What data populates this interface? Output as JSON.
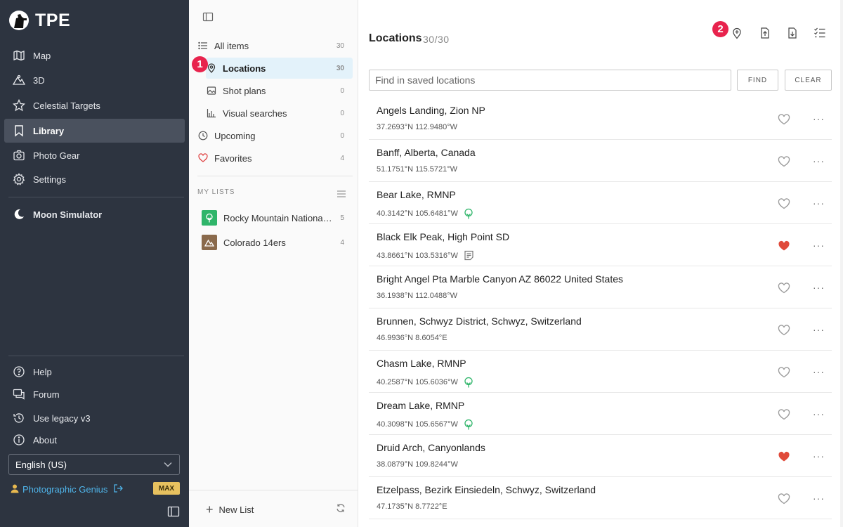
{
  "brand": {
    "name": "TPE"
  },
  "nav": {
    "items": [
      {
        "label": "Map",
        "icon": "map-icon"
      },
      {
        "label": "3D",
        "icon": "mountain-icon"
      },
      {
        "label": "Celestial Targets",
        "icon": "star-icon"
      },
      {
        "label": "Library",
        "icon": "bookmark-icon",
        "active": true
      },
      {
        "label": "Photo Gear",
        "icon": "camera-icon"
      },
      {
        "label": "Settings",
        "icon": "gear-icon"
      },
      {
        "label": "Moon Simulator",
        "icon": "moon-icon"
      }
    ],
    "bottom": [
      {
        "label": "Help",
        "icon": "help-icon"
      },
      {
        "label": "Forum",
        "icon": "forum-icon"
      },
      {
        "label": "Use legacy v3",
        "icon": "history-icon"
      },
      {
        "label": "About",
        "icon": "info-icon"
      }
    ],
    "language": "English (US)",
    "user": "Photographic Genius",
    "badge": "MAX"
  },
  "library": {
    "items": [
      {
        "label": "All items",
        "count": "30",
        "icon": "list-icon"
      },
      {
        "label": "Locations",
        "count": "30",
        "icon": "pin-icon",
        "active": true
      },
      {
        "label": "Shot plans",
        "count": "0",
        "icon": "image-icon"
      },
      {
        "label": "Visual searches",
        "count": "0",
        "icon": "chart-icon"
      },
      {
        "label": "Upcoming",
        "count": "0",
        "icon": "clock-icon"
      },
      {
        "label": "Favorites",
        "count": "4",
        "icon": "heart-icon"
      }
    ],
    "my_lists_title": "MY LISTS",
    "lists": [
      {
        "name": "Rocky Mountain National Park",
        "count": "5",
        "color": "#2fb56a"
      },
      {
        "name": "Colorado 14ers",
        "count": "4",
        "color": "#8a6a4c"
      }
    ],
    "new_list": "New List"
  },
  "callouts": {
    "one": "1",
    "two": "2"
  },
  "main": {
    "title": "Locations",
    "count": "30/30",
    "search_placeholder": "Find in saved locations",
    "find": "FIND",
    "clear": "CLEAR",
    "rows": [
      {
        "name": "Angels Landing, Zion NP",
        "coords": "37.2693°N 112.9480°W",
        "fav": false,
        "extra": ""
      },
      {
        "name": "Banff, Alberta, Canada",
        "coords": "51.1751°N 115.5721°W",
        "fav": false,
        "extra": ""
      },
      {
        "name": "Bear Lake, RMNP",
        "coords": "40.3142°N 105.6481°W",
        "fav": false,
        "extra": "list"
      },
      {
        "name": "Black Elk Peak, High Point SD",
        "coords": "43.8661°N 103.5316°W",
        "fav": true,
        "extra": "note"
      },
      {
        "name": "Bright Angel Pta Marble Canyon AZ 86022 United States",
        "coords": "36.1938°N 112.0488°W",
        "fav": false,
        "extra": ""
      },
      {
        "name": "Brunnen, Schwyz District, Schwyz, Switzerland",
        "coords": "46.9936°N 8.6054°E",
        "fav": false,
        "extra": ""
      },
      {
        "name": "Chasm Lake, RMNP",
        "coords": "40.2587°N 105.6036°W",
        "fav": false,
        "extra": "list"
      },
      {
        "name": "Dream Lake, RMNP",
        "coords": "40.3098°N 105.6567°W",
        "fav": false,
        "extra": "list"
      },
      {
        "name": "Druid Arch, Canyonlands",
        "coords": "38.0879°N 109.8244°W",
        "fav": true,
        "extra": ""
      },
      {
        "name": "Etzelpass, Bezirk Einsiedeln, Schwyz, Switzerland",
        "coords": "47.1735°N 8.7722°E",
        "fav": false,
        "extra": ""
      }
    ]
  }
}
